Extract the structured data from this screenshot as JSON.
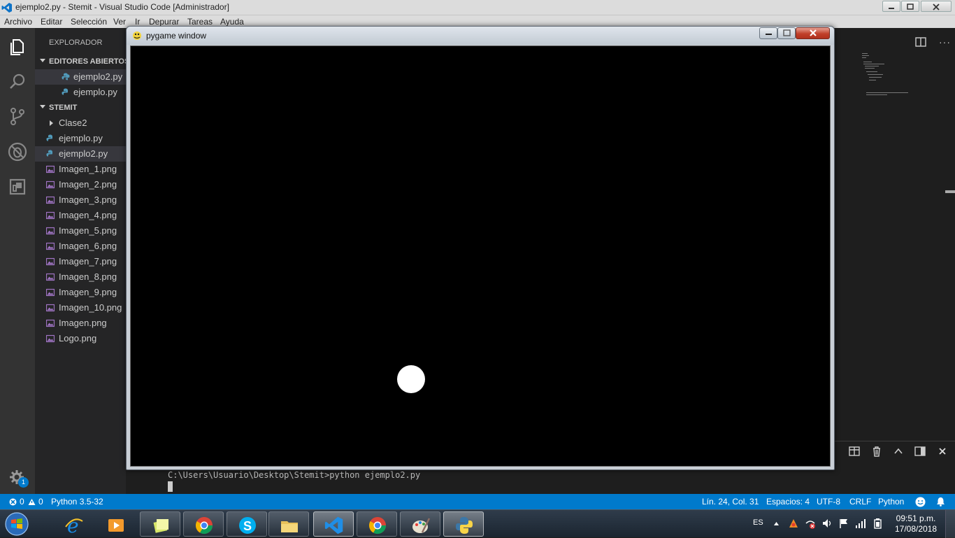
{
  "app": {
    "window_title": "ejemplo2.py - Stemit - Visual Studio Code [Administrador]"
  },
  "menu": [
    "Archivo",
    "Editar",
    "Selección",
    "Ver",
    "Ir",
    "Depurar",
    "Tareas",
    "Ayuda"
  ],
  "sidebar": {
    "header": "EXPLORADOR",
    "open_editors_title": "EDITORES ABIERTOS",
    "open_editors": [
      "ejemplo2.py",
      "ejemplo.py"
    ],
    "project_title": "STEMIT",
    "folder": "Clase2",
    "files": [
      "ejemplo.py",
      "ejemplo2.py",
      "Imagen_1.png",
      "Imagen_2.png",
      "Imagen_3.png",
      "Imagen_4.png",
      "Imagen_5.png",
      "Imagen_6.png",
      "Imagen_7.png",
      "Imagen_8.png",
      "Imagen_9.png",
      "Imagen_10.png",
      "Imagen.png",
      "Logo.png"
    ]
  },
  "activity": {
    "settings_badge": "1"
  },
  "pygame": {
    "title": "pygame window"
  },
  "terminal": {
    "command": "C:\\Users\\Usuario\\Desktop\\Stemit>python ejemplo2.py"
  },
  "status": {
    "errors": "0",
    "warnings": "0",
    "interpreter": "Python 3.5-32",
    "position": "Lín. 24, Col. 31",
    "spaces": "Espacios: 4",
    "encoding": "UTF-8",
    "eol": "CRLF",
    "language": "Python"
  },
  "taskbar": {
    "language": "ES",
    "time": "09:51 p.m.",
    "date": "17/08/2018"
  },
  "colors": {
    "statusbar": "#007acc",
    "activitybar": "#333333",
    "sidebar": "#252526",
    "editor": "#1e1e1e",
    "python_file_icon": "#519aba",
    "image_file_icon": "#a074c4"
  },
  "icons": {
    "explorer": "files-icon",
    "search": "search-icon",
    "scm": "source-control-icon",
    "debug": "debug-icon",
    "extensions": "extensions-icon",
    "settings": "gear-icon"
  }
}
